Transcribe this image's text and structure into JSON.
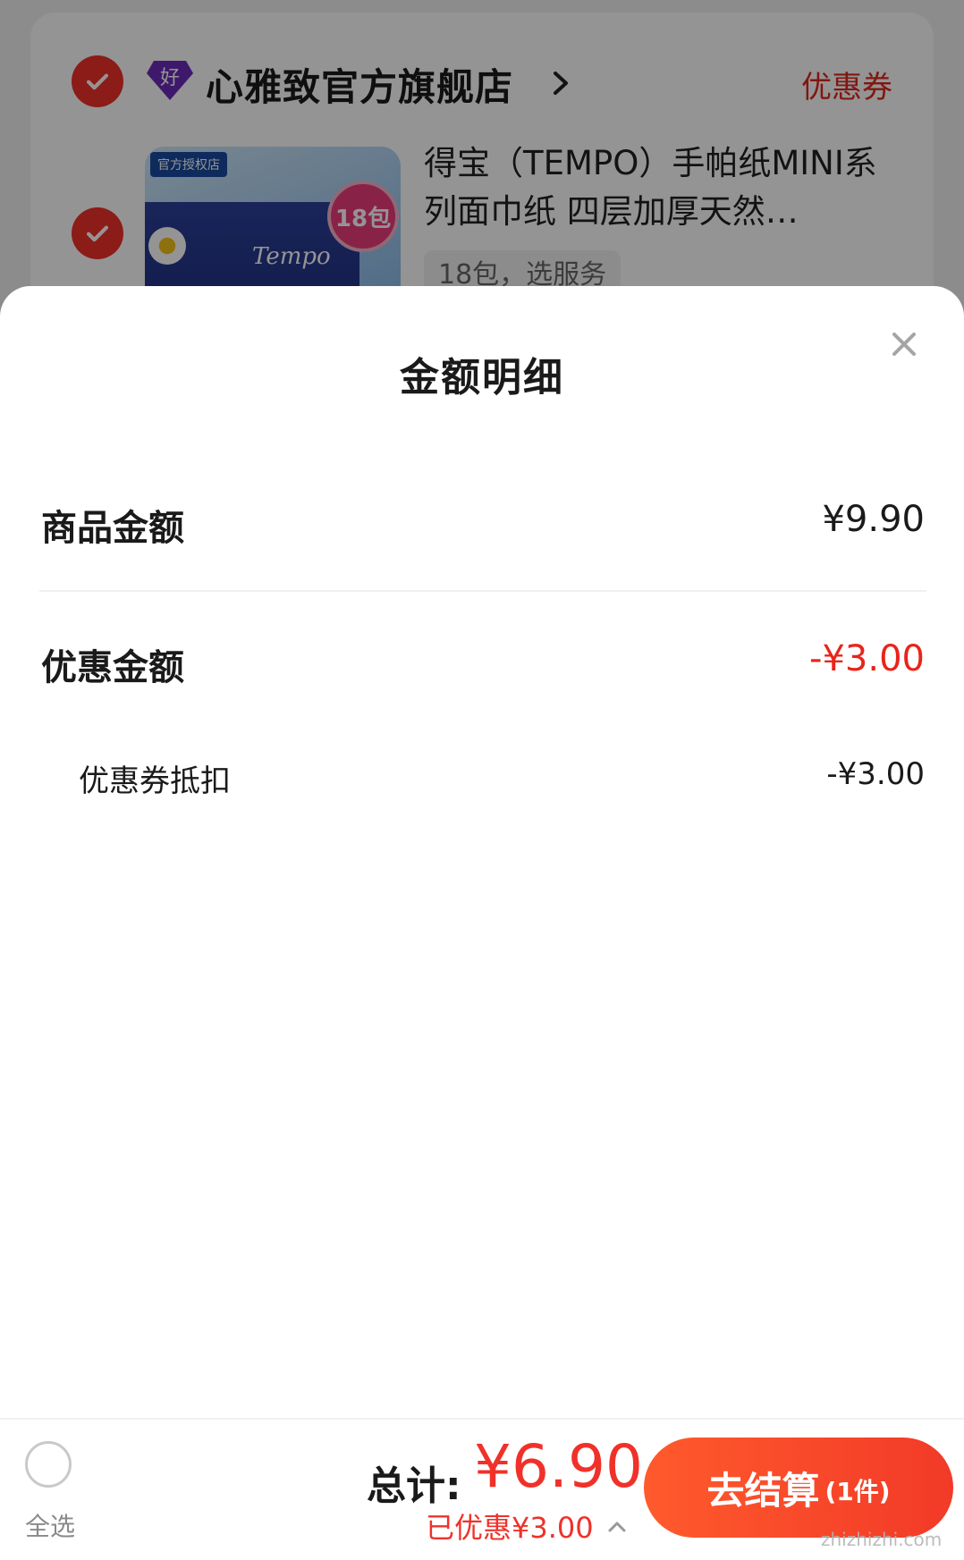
{
  "background_cart": {
    "store_badge": "好",
    "store_name": "心雅致官方旗舰店",
    "coupon_link": "优惠券",
    "product_title": "得宝（TEMPO）手帕纸MINI系列面巾纸 四层加厚天然…",
    "product_spec": "18包，选服务",
    "thumb_tag": "官方授权店",
    "thumb_brand": "Tempo",
    "thumb_seal": "18包"
  },
  "sheet": {
    "title": "金额明细",
    "goods_label": "商品金额",
    "goods_value": "¥9.90",
    "discount_label": "优惠金额",
    "discount_value": "-¥3.00",
    "coupon_deduct_label": "优惠券抵扣",
    "coupon_deduct_value": "-¥3.00"
  },
  "bottom_bar": {
    "select_all": "全选",
    "total_label": "总计:",
    "total_amount": "¥6.90",
    "savings": "已优惠¥3.00",
    "checkout_label": "去结算",
    "checkout_count": "(1件)"
  },
  "colors": {
    "accent_red": "#f0312a",
    "discount_red": "#e8241b"
  },
  "icons": {
    "close": "close-icon",
    "chevron_right": "chevron-right-icon",
    "chevron_up": "chevron-up-icon",
    "check": "check-icon"
  },
  "watermark": "zhizhizhi.com"
}
